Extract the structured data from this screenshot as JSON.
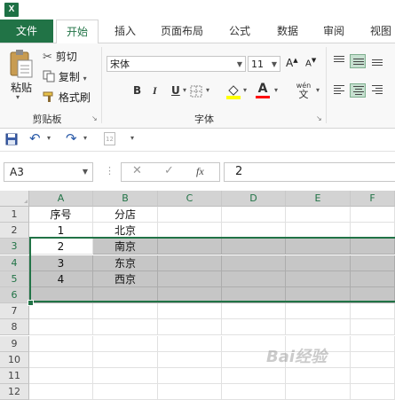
{
  "ribbon": {
    "tabs": [
      "文件",
      "开始",
      "插入",
      "页面布局",
      "公式",
      "数据",
      "审阅",
      "视图"
    ],
    "active_tab": "开始",
    "clipboard": {
      "paste": "粘贴",
      "cut": "剪切",
      "copy": "复制",
      "format_painter": "格式刷",
      "group_label": "剪贴板"
    },
    "font": {
      "name": "宋体",
      "size": "11",
      "group_label": "字体",
      "bold": "B",
      "italic": "I",
      "underline": "U",
      "phonetic": "wén"
    },
    "colors": {
      "fill": "#ffff00",
      "font": "#ff0000",
      "brand": "#217346"
    }
  },
  "formula_bar": {
    "name_box": "A3",
    "fx": "fx",
    "value": "2"
  },
  "grid": {
    "columns": [
      "A",
      "B",
      "C",
      "D",
      "E",
      "F"
    ],
    "rows": [
      "1",
      "2",
      "3",
      "4",
      "5",
      "6",
      "7",
      "8",
      "9",
      "10",
      "11",
      "12"
    ],
    "cells": {
      "A1": "序号",
      "B1": "分店",
      "A2": "1",
      "B2": "北京",
      "A3": "2",
      "B3": "南京",
      "A4": "3",
      "B4": "东京",
      "A5": "4",
      "B5": "西京"
    }
  },
  "watermark": "Bai经验"
}
